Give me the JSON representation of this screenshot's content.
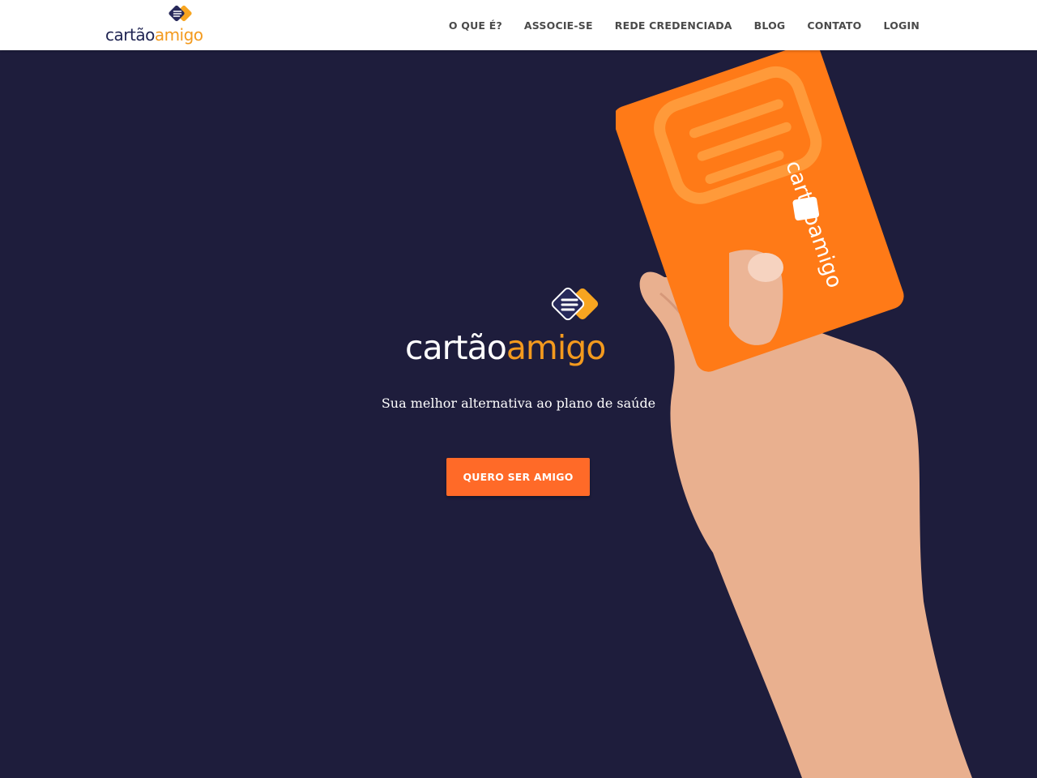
{
  "header": {
    "logo": {
      "word1": "cartão",
      "word2": "amigo"
    },
    "nav": [
      {
        "label": "O QUE É?"
      },
      {
        "label": "ASSOCIE-SE"
      },
      {
        "label": "REDE CREDENCIADA"
      },
      {
        "label": "BLOG"
      },
      {
        "label": "CONTATO"
      },
      {
        "label": "LOGIN"
      }
    ]
  },
  "hero": {
    "logo": {
      "word1": "cartão",
      "word2": "amigo"
    },
    "tagline": "Sua melhor alternativa ao plano de saúde",
    "cta_label": "QUERO SER AMIGO",
    "card_brand": "cartãoamigo"
  },
  "colors": {
    "hero_background": "#1e1d3c",
    "header_background": "#ffffff",
    "cta": "#ff6a28",
    "brand_orange": "#f39a1e",
    "brand_navy": "#1f2452"
  }
}
